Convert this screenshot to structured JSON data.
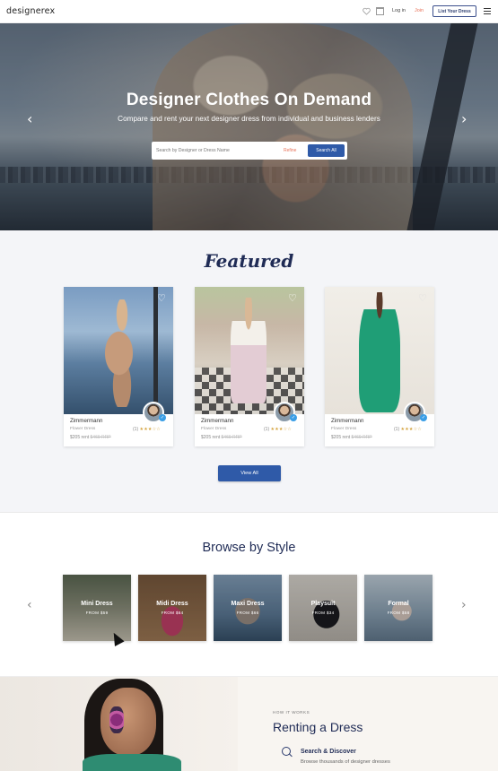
{
  "header": {
    "logo": "designerex",
    "login": "Log in",
    "join": "Join",
    "list_button": "List Your Dress",
    "icons": [
      "heart-icon",
      "bag-icon",
      "menu-icon"
    ]
  },
  "hero": {
    "title": "Designer Clothes On Demand",
    "subtitle": "Compare and rent your next designer dress from individual and business lenders",
    "search_placeholder": "Search by Designer or Dress Name",
    "refine": "Refine",
    "search_button": "Search All",
    "prev_arrow": "‹",
    "next_arrow": "›"
  },
  "featured": {
    "title": "Featured",
    "cards": [
      {
        "brand": "Zimmermann",
        "type": "Flower Dress",
        "price": "$205 rent",
        "rrp": "$469 RRP",
        "reviews": "(1)",
        "stars": "★★★☆☆"
      },
      {
        "brand": "Zimmermann",
        "type": "Flower Dress",
        "price": "$205 rent",
        "rrp": "$469 RRP",
        "reviews": "(1)",
        "stars": "★★★☆☆"
      },
      {
        "brand": "Zimmermann",
        "type": "Flower Dress",
        "price": "$205 rent",
        "rrp": "$469 RRP",
        "reviews": "(1)",
        "stars": "★★★☆☆"
      }
    ],
    "view_all": "View All"
  },
  "browse": {
    "title": "Browse by Style",
    "prev_arrow": "‹",
    "next_arrow": "›",
    "styles": [
      {
        "name": "Mini Dress",
        "from": "FROM $59"
      },
      {
        "name": "Midi Dress",
        "from": "FROM $64"
      },
      {
        "name": "Maxi Dress",
        "from": "FROM $66"
      },
      {
        "name": "Playsuit",
        "from": "FROM $34"
      },
      {
        "name": "Formal",
        "from": "FROM $58"
      }
    ]
  },
  "how": {
    "kicker": "HOW IT WORKS",
    "title": "Renting a Dress",
    "step_title": "Search & Discover",
    "step_desc": "Browse thousands of designer dresses"
  },
  "colors": {
    "brand_blue": "#2f5aa8",
    "navy": "#1f2b55",
    "accent_orange": "#e8735a",
    "star_gold": "#d4a33c"
  }
}
